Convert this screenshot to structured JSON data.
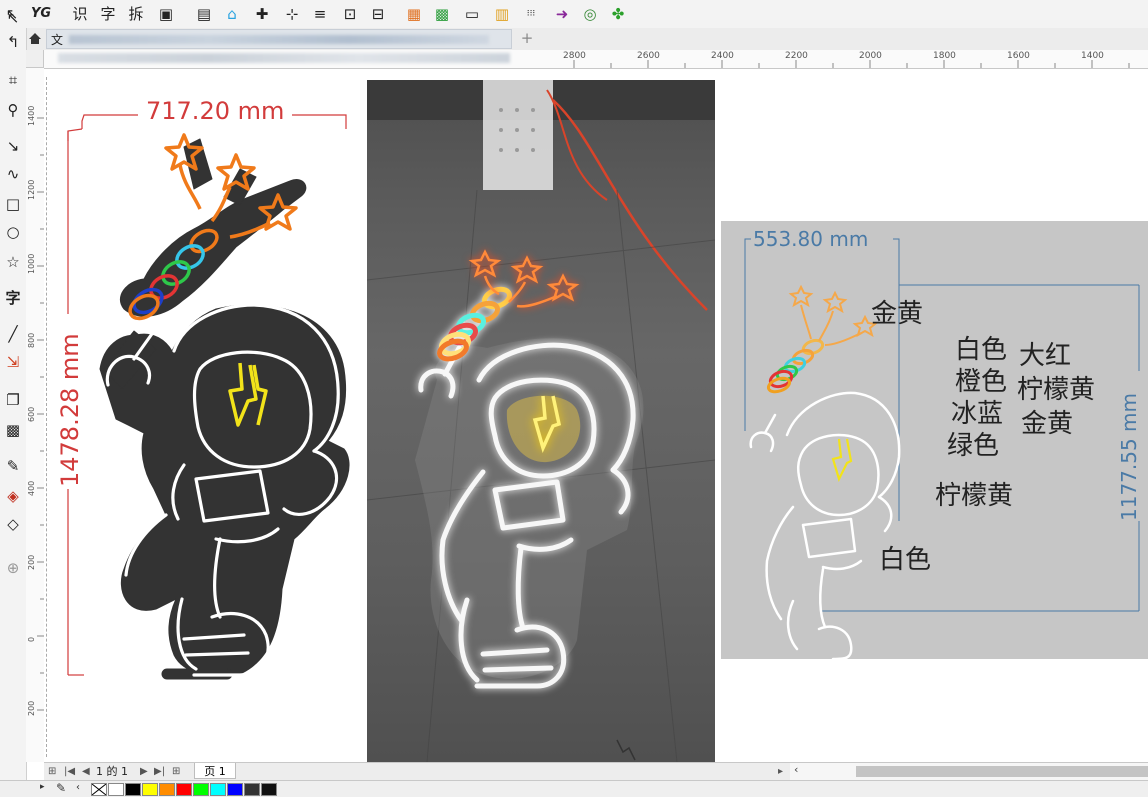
{
  "toolbar": {
    "items": [
      "↖",
      "YG",
      "识",
      "字",
      "拆",
      "▣",
      "▤",
      "⌂",
      "✚",
      "⊹",
      "≡",
      "⊡",
      "⊟",
      "▦",
      "▩",
      "▭",
      "▥",
      "⁝⁝⁝",
      "➜",
      "◎",
      "✤"
    ]
  },
  "tabbar": {
    "home_icon": "home-icon",
    "tab_label": "文",
    "add_label": "+"
  },
  "toolbox": {
    "tools": [
      "↖",
      "↰",
      "⌗",
      "⚲",
      "↘",
      "∿",
      "□",
      "○",
      "☆",
      "字",
      "╱",
      "⇲",
      "❐",
      "▩",
      "✎",
      "◈",
      "◇",
      "⊕"
    ]
  },
  "rulers": {
    "h_labels": [
      "2800",
      "2600",
      "2400",
      "2200",
      "2000",
      "1800",
      "1600",
      "1400"
    ],
    "v_labels": [
      "1400",
      "1200",
      "1000",
      "800",
      "600",
      "400",
      "200",
      "0",
      "200"
    ]
  },
  "canvas": {
    "dim_width_left": "717.20 mm",
    "dim_height_left": "1478.28 mm",
    "dim_width_right": "553.80 mm",
    "dim_height_right": "1177.55 mm",
    "labels": {
      "jin_huang_top": "金黄",
      "bai_se": "白色",
      "da_hong": "大红",
      "cheng_se": "橙色",
      "ning_meng_huang": "柠檬黄",
      "bing_lan": "冰蓝",
      "jin_huang": "金黄",
      "lv_se": "绿色",
      "ning_meng_huang_2": "柠檬黄",
      "bai_se_2": "白色"
    }
  },
  "pagebar": {
    "page_info": "1 的 1",
    "page_tab": "页 1"
  },
  "colors": {
    "dim_red": "#d23b3b",
    "dim_blue": "#4a7aa6",
    "neon_orange": "#f07a1a",
    "neon_yellow": "#f2e31a",
    "body_dark": "#333333",
    "gray_panel": "#c6c6c6"
  },
  "palette": {
    "swatches": [
      "#ffffff",
      "#000000",
      "#ffff00",
      "#ff8c00",
      "#ff0000",
      "#00ff00",
      "#00ffff",
      "#0000ff",
      "#333333",
      "#111111"
    ]
  }
}
